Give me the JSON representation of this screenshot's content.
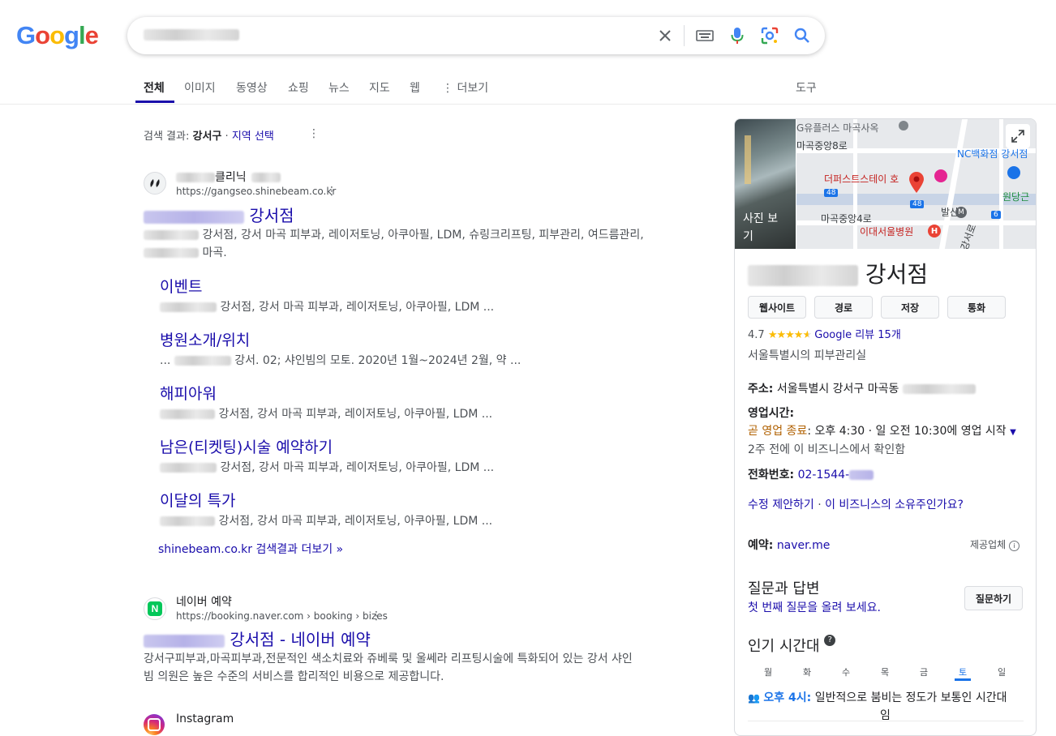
{
  "logo": "Google",
  "search": {
    "placeholder": ""
  },
  "tabs": [
    "전체",
    "이미지",
    "동영상",
    "쇼핑",
    "뉴스",
    "지도",
    "웹",
    "더보기"
  ],
  "tools_label": "도구",
  "location": {
    "prefix": "검색 결과:",
    "place": "강서구",
    "sep": "·",
    "change": "지역 선택"
  },
  "result1": {
    "site_name": "클리닉",
    "url": "https://gangseo.shinebeam.co.kr",
    "title_suffix": "강서점",
    "snippet_line1": "강서점, 강서 마곡 피부과, 레이저토닝, 아쿠아필, LDM, 슈링크리프팅, 피부관리, 여드름관리,",
    "snippet_line2": "마곡.",
    "sitelinks": [
      {
        "title": "이벤트",
        "desc": "강서점, 강서 마곡 피부과, 레이저토닝, 아쿠아필, LDM ..."
      },
      {
        "title": "병원소개/위치",
        "desc_prefix": "...",
        "desc": "강서. 02; 샤인빔의 모토. 2020년 1월~2024년 2월, 약 ..."
      },
      {
        "title": "해피아워",
        "desc": "강서점, 강서 마곡 피부과, 레이저토닝, 아쿠아필, LDM ..."
      },
      {
        "title": "남은(티켓팅)시술 예약하기",
        "desc": "강서점, 강서 마곡 피부과, 레이저토닝, 아쿠아필, LDM ..."
      },
      {
        "title": "이달의 특가",
        "desc": "강서점, 강서 마곡 피부과, 레이저토닝, 아쿠아필, LDM ..."
      }
    ],
    "more_results": "shinebeam.co.kr 검색결과 더보기 »"
  },
  "result2": {
    "site_name": "네이버 예약",
    "url": "https://booking.naver.com › booking › bizes",
    "title_suffix": "강서점 - 네이버 예약",
    "snippet_line1": "강서구피부과,마곡피부과,전문적인 색소치료와 쥬베룩 및 울쎄라 리프팅시술에 특화되어 있는 강서 샤인",
    "snippet_line2": "빔 의원은 높은 수준의 서비스를 합리적인 비용으로 제공합니다."
  },
  "result3": {
    "site_name": "Instagram"
  },
  "kp": {
    "photo_label": "사진 보기",
    "map_labels": {
      "gplus": "G유플러스 마곡사옥",
      "road1": "마곡중앙8로",
      "nc": "NC백화점 강서점",
      "hotel": "더퍼스트스테이 호",
      "wondang": "원당근",
      "road2": "마곡중앙4로",
      "balsan": "발산",
      "hospital": "이대서울병원",
      "gangseoro": "강서로",
      "route48a": "48",
      "route48b": "48",
      "route6": "6"
    },
    "name_suffix": "강서점",
    "buttons": [
      "웹사이트",
      "경로",
      "저장",
      "통화"
    ],
    "rating": "4.7",
    "reviews": "Google 리뷰 15개",
    "category": "서울특별시의 피부관리실",
    "address_label": "주소:",
    "address": "서울특별시 강서구 마곡동",
    "hours_label": "영업시간:",
    "hours_status": "곧 영업 종료",
    "hours_detail": ": 오후 4:30 · 일 오전 10:30에 영업 시작",
    "verified": "2주 전에 이 비즈니스에서 확인함",
    "phone_label": "전화번호:",
    "phone": "02-1544-",
    "suggest_edit": "수정 제안하기",
    "sep": "·",
    "own_business": "이 비즈니스의 소유주인가요?",
    "booking_label": "예약:",
    "booking_link": "naver.me",
    "provider": "제공업체",
    "qa_title": "질문과 답변",
    "qa_cta": "첫 번째 질문을 올려 보세요.",
    "qa_button": "질문하기",
    "popular_title": "인기 시간대",
    "days": [
      "월",
      "화",
      "수",
      "목",
      "금",
      "토",
      "일"
    ],
    "busy_time": "오후 4시:",
    "busy_desc_line1": "일반적으로 붐비는 정도가 보통인 시간대",
    "busy_desc_line2": "임"
  },
  "colors": {
    "link": "#1a0dab",
    "star": "#fbbc04",
    "closing": "#b06000",
    "accent": "#1a73e8"
  }
}
